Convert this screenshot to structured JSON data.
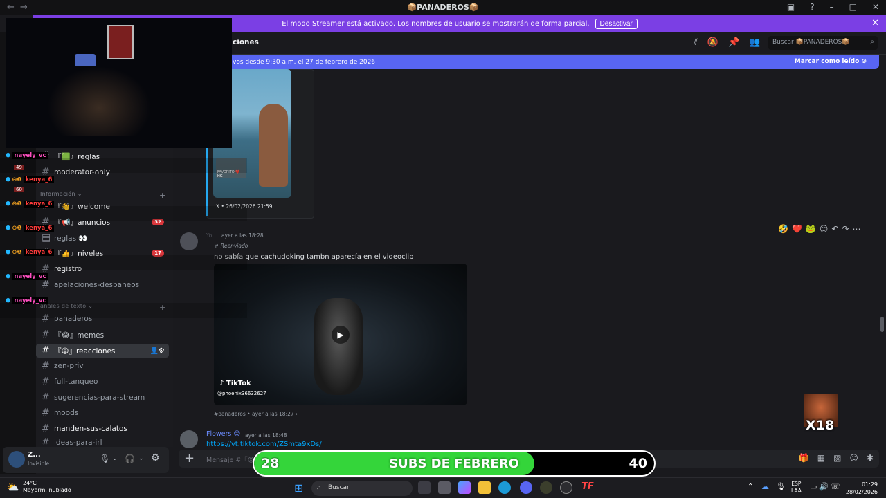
{
  "window": {
    "title": "📦PANADEROS📦"
  },
  "streamer_banner": {
    "text": "El modo Streamer está activado. Los nombres de usuario se mostrarán de forma parcial.",
    "button": "Desactivar"
  },
  "header": {
    "channel_name": "ciones",
    "search_placeholder": "Buscar 📦PANADEROS📦"
  },
  "new_messages": {
    "text": "vos desde 9:30 a.m. el 27 de febrero de 2026",
    "mark_read": "Marcar como leído"
  },
  "sidebar": {
    "category_info": "Información",
    "category_text": "anales de texto",
    "channels": [
      {
        "name": "『🟩』reglas",
        "style": "bold"
      },
      {
        "name": "moderator-only",
        "style": "bold"
      },
      {
        "name": "『👋』welcome",
        "style": "bold"
      },
      {
        "name": "『📢』anuncios",
        "style": "bold",
        "badge": "32"
      },
      {
        "name": "reglas 👀",
        "style": "muted"
      },
      {
        "name": "『👍』niveles",
        "style": "bold",
        "badge": "17"
      },
      {
        "name": "registro",
        "style": "bold"
      },
      {
        "name": "apelaciones-desbaneos",
        "style": "muted"
      },
      {
        "name": "panaderos",
        "style": "muted"
      },
      {
        "name": "『😂』memes",
        "style": "normal"
      },
      {
        "name": "『😡』reacciones",
        "style": "active"
      },
      {
        "name": "zen-priv",
        "style": "muted"
      },
      {
        "name": "full-tanqueo",
        "style": "muted"
      },
      {
        "name": "sugerencias-para-stream",
        "style": "muted"
      },
      {
        "name": "moods",
        "style": "muted"
      },
      {
        "name": "manden-sus-calatos",
        "style": "bold"
      },
      {
        "name": "ideas-para-irl",
        "style": "muted"
      }
    ]
  },
  "messages": {
    "first_embed": {
      "tiktok_footer": "X • 26/02/2026 21:59",
      "overlay_text": "FAVORITO ❤️ HG"
    },
    "forwarded": {
      "author": "Yo",
      "time": "ayer a las 18:28",
      "forwarded_label": "Reenviado",
      "text": "no sabía que cachudoking tambn aparecía en el videoclip",
      "tiktok_brand": "TikTok",
      "tiktok_user": "@phoenix36632627",
      "source": "#panaderos • ayer a las 18:27"
    },
    "next": {
      "author": "Flowers 😊",
      "time": "ayer a las 18:48",
      "link": "https://vt.tiktok.com/ZSmta9xDs/"
    }
  },
  "composer": {
    "placeholder": "Mensaje #『😡』"
  },
  "user_panel": {
    "name": "Z...",
    "status": "Invisible"
  },
  "overlay": {
    "chat_names": [
      {
        "name": "nayely_vc",
        "color": "#ff4fc0",
        "count": "49"
      },
      {
        "name": "kenya_6",
        "color": "#ff3b3b",
        "count": "60"
      },
      {
        "name": "kenya_6",
        "color": "#ff3b3b"
      },
      {
        "name": "kenya_6",
        "color": "#ff3b3b"
      },
      {
        "name": "kenya_6",
        "color": "#ff3b3b"
      },
      {
        "name": "nayely_vc",
        "color": "#ff4fc0"
      },
      {
        "name": "nayely_vc",
        "color": "#ff4fc0"
      }
    ],
    "subs": {
      "current": "28",
      "label": "SUBS DE FEBRERO",
      "goal": "40",
      "progress": 0.7
    },
    "multiplier": "X18"
  },
  "taskbar": {
    "temperature": "24°C",
    "weather": "Mayorm. nublado",
    "search": "Buscar",
    "lang_top": "ESP",
    "lang_bottom": "LAA",
    "time": "01:29",
    "date": "28/02/2026"
  }
}
